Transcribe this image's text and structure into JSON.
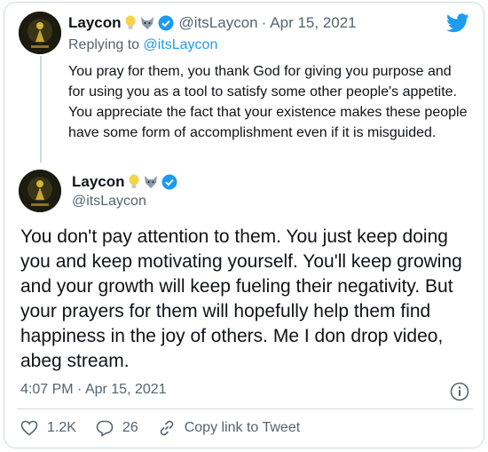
{
  "reply_tweet": {
    "author_name": "Laycon",
    "handle": "@itsLaycon",
    "separator": "·",
    "date": "Apr 15, 2021",
    "replying_label": "Replying to",
    "replying_to": "@itsLaycon",
    "text": "You pray for them, you thank God for giving you purpose and for using you as a tool to satisfy some other people's appetite. You appreciate the fact that your existence makes these people have some form of accomplishment even if it is misguided."
  },
  "main_tweet": {
    "author_name": "Laycon",
    "handle": "@itsLaycon",
    "text": "You don't pay attention to them. You just keep doing you and keep motivating yourself. You'll keep growing and your growth will keep fueling their negativity. But your prayers for them will hopefully help them find happiness in the joy of others. Me I don drop video, abeg stream.",
    "time": "4:07 PM",
    "separator": "·",
    "date": "Apr 15, 2021"
  },
  "actions": {
    "likes": "1.2K",
    "replies": "26",
    "copy_link": "Copy link to Tweet"
  },
  "icons": {
    "brand": "twitter-bird-icon",
    "verified": "verified-badge-icon",
    "like": "heart-icon",
    "reply": "reply-bubble-icon",
    "link": "link-icon",
    "info": "info-icon",
    "emoji_1": "light-bulb-emoji",
    "emoji_2": "wolf-emoji"
  },
  "colors": {
    "accent": "#1d9bf0",
    "text_primary": "#0f1419",
    "text_secondary": "#536471",
    "border": "#cfd9de"
  }
}
